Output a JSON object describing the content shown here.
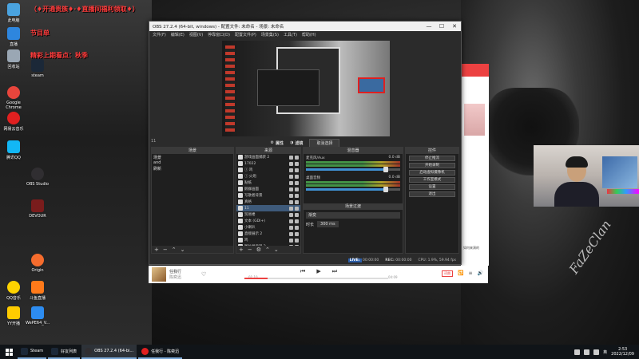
{
  "desktop": {
    "banner_lines": [
      "（♦开通贵族♦·♦直播间福利领取♦）",
      "节目单",
      "精彩上期看点：秋季"
    ],
    "icons": [
      {
        "label": "此电脑",
        "color": "#4aa3df"
      },
      {
        "label": "直播",
        "color": "#2e86de"
      },
      {
        "label": "回收站",
        "color": "#9aa7b4"
      },
      {
        "label": "Google Chrome",
        "color": "#e8453c"
      },
      {
        "label": "网易云音乐",
        "color": "#e02020"
      },
      {
        "label": "腾讯QQ",
        "color": "#12b7f5"
      },
      {
        "label": "OBS Studio",
        "color": "#302e31"
      },
      {
        "label": "DEVOUR",
        "color": "#7a1c1c"
      },
      {
        "label": "Origin",
        "color": "#f56c2d"
      },
      {
        "label": "QQ音乐",
        "color": "#ffd300"
      },
      {
        "label": "斗鱼直播",
        "color": "#ff7a1a"
      },
      {
        "label": "YY开播",
        "color": "#ffcc00"
      },
      {
        "label": "WePE64_V...",
        "color": "#2d8cf0"
      },
      {
        "label": "steam",
        "color": "#1b2838"
      }
    ]
  },
  "obs": {
    "title": "OBS 27.2.4 (64-bit, windows) - 配置文件: 未命名 - 场景: 未命名",
    "menu": [
      "文件(F)",
      "编辑(E)",
      "视图(V)",
      "停靠窗口(D)",
      "配置文件(P)",
      "场景集(S)",
      "工具(T)",
      "帮助(H)"
    ],
    "controls": [
      "—",
      "☐",
      "✕"
    ],
    "scene_label": "11",
    "preview_buttons": [
      "属性",
      "滤镜",
      "取消选择"
    ],
    "scenes_header": "场景",
    "scenes": [
      "场景",
      "and",
      "刷新"
    ],
    "sources_header": "来源",
    "sources": [
      "游戏画面捕获 2",
      "17022",
      "ⓘ 鸡",
      "ⓘ 火炮",
      "贴纸",
      "鹅群画面",
      "写歌者背景",
      "真格",
      "11",
      "贸易楼",
      "文本 (GDI+)",
      "小喇叭",
      "直接展示 2",
      "鸡",
      "图片显示器 2"
    ],
    "mixer_header": "混音器",
    "mixer_tracks": [
      {
        "name": "麦克风/Aux",
        "db": "0.0 dB",
        "level": 0.85
      },
      {
        "name": "桌面音频",
        "db": "0.0 dB",
        "level": 0.85
      }
    ],
    "transition_header": "场景过渡",
    "transition_type": "渐变",
    "transition_duration_label": "时长",
    "transition_duration": "300 ms",
    "controls_header": "控件",
    "control_buttons": [
      "停止推流",
      "开始录制",
      "启动虚拟摄像机",
      "工作室模式",
      "设置",
      "退出"
    ],
    "status": {
      "live_label": "LIVE:",
      "live_time": "00:00:00",
      "rec_label": "REC:",
      "rec_time": "00:00:00",
      "cpu": "CPU: 1.9%, 59.94 fps"
    }
  },
  "player": {
    "track": "任我行",
    "artist": "陈奕迅",
    "time_elapsed": "01:10",
    "time_total": "04:09",
    "progress": 0.16,
    "tag": "词曲",
    "right_icons": [
      "🔁",
      "≡",
      "🔊"
    ]
  },
  "netease": {
    "caption": "如何来演的"
  },
  "taskbar": {
    "items": [
      {
        "label": "Steam",
        "color": "#1b2838"
      },
      {
        "label": "好友列表",
        "color": "#1b2838"
      },
      {
        "label": "OBS 27.2.4 (64-bi...",
        "color": "#302e31",
        "active": true
      },
      {
        "label": "任我行 - 陈奕迅",
        "color": "#e02020"
      }
    ],
    "time": "2:53",
    "date": "2022/12/09",
    "tray_text": "英"
  }
}
